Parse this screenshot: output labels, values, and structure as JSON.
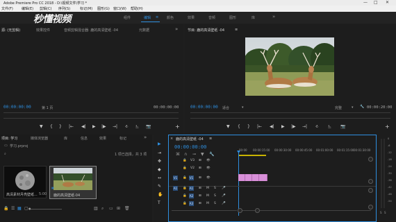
{
  "app": {
    "title": "Adobe Premiere Pro CC 2018 - D:\\视频文件\\学习 *",
    "minimize": "—",
    "maximize": "□",
    "close": "✕"
  },
  "menu": [
    "文件(F)",
    "编辑(E)",
    "剪辑(C)",
    "序列(S)",
    "标记(M)",
    "图形(G)",
    "窗口(W)",
    "帮助(H)"
  ],
  "workspaces": [
    {
      "label": "组件",
      "active": false
    },
    {
      "label": "编辑",
      "active": true
    },
    {
      "label": "颜色",
      "active": false
    },
    {
      "label": "效果",
      "active": false
    },
    {
      "label": "音频",
      "active": false
    },
    {
      "label": "图形",
      "active": false
    },
    {
      "label": "库",
      "active": false
    }
  ],
  "more_label": "»",
  "workspace_menu_icon": "≡",
  "watermark": "秒懂视频",
  "source_panel": {
    "tabs": [
      "源: (无剪辑)",
      "效果控件",
      "音频剪辑混合器: 鹿的高清壁纸 -04",
      "元数据"
    ],
    "tab_more": "»",
    "timecode_left": "00:00:00:00",
    "page": "第 1 页",
    "timecode_right": "00:00:00:00"
  },
  "program_panel": {
    "tab": "节目: 鹿的高清壁纸 -04",
    "tab_menu": "≡",
    "timecode_left": "00:00:00:00",
    "fit": "适合",
    "quality": "完整",
    "timecode_right": "00:00:20:00"
  },
  "transport": [
    "▼",
    "{",
    "}",
    "|←",
    "◀|",
    "▶",
    "|▶",
    "→|",
    "⎀",
    "⎁",
    "📷"
  ],
  "project_panel": {
    "tabs": [
      "项目: 学习",
      "媒体浏览器",
      "库",
      "信息",
      "效果",
      "标记"
    ],
    "tab_more": "»",
    "project_file": "学习.prproj",
    "search_placeholder": "",
    "selection_info": "1 项已选择，共 3 项",
    "items": [
      {
        "name": "高清素材月亮壁纸...",
        "duration": "5:00"
      },
      {
        "name": "鹿的高清壁纸-04",
        "duration": "5:00"
      }
    ]
  },
  "timeline_panel": {
    "tab": "鹿的高清壁纸 -04",
    "tab_menu": "≡",
    "timecode": "00:00:00:00",
    "ruler": [
      "00:00",
      "00:00:15:00",
      "00:00:30:00",
      "00:00:45:00",
      "00:01:00:00",
      "00:01:15:00",
      "00:01:30:00",
      "00:01:45:00"
    ],
    "tracks": [
      {
        "label": "V3",
        "type": "video"
      },
      {
        "label": "V2",
        "type": "video"
      },
      {
        "label": "V1",
        "type": "video"
      },
      {
        "label": "A1",
        "type": "audio"
      },
      {
        "label": "A2",
        "type": "audio"
      },
      {
        "label": "A3",
        "type": "audio"
      }
    ],
    "source_patch_video": "V1",
    "source_patch_audio": "A1",
    "track_controls_video": [
      "🔒",
      "⊞",
      "👁"
    ],
    "track_controls_audio": [
      "🔒",
      "⊞",
      "M",
      "S",
      "🎤"
    ]
  },
  "tools": [
    "▶",
    "⇥",
    "✥",
    "◆",
    "↔",
    "✎",
    "✋",
    "T"
  ],
  "meter_labels": [
    "0",
    "-6",
    "-12",
    "-18",
    "-24",
    "-30",
    "-36",
    "-42",
    "-48",
    "-54"
  ],
  "meter_footer": [
    "S",
    "S"
  ],
  "colors": {
    "accent": "#2e8fe0",
    "clip": "#d88fd8",
    "work_area": "#c9b300"
  }
}
